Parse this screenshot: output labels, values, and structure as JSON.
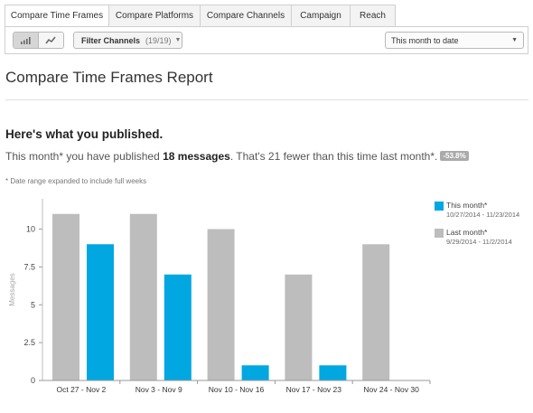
{
  "tabs": [
    {
      "label": "Compare Time Frames",
      "active": true
    },
    {
      "label": "Compare Platforms",
      "active": false
    },
    {
      "label": "Compare Channels",
      "active": false
    },
    {
      "label": "Campaign",
      "active": false
    },
    {
      "label": "Reach",
      "active": false
    }
  ],
  "toolbar": {
    "view_icons": [
      "bar-chart-icon",
      "line-chart-icon"
    ],
    "filter_label": "Filter Channels",
    "filter_count": "(19/19)",
    "date_range_selected": "This month to date"
  },
  "report": {
    "title": "Compare Time Frames Report",
    "heading": "Here's what you published.",
    "summary_prefix": "This month* you have published ",
    "summary_count": "18 messages",
    "summary_suffix": ". That's 21 fewer than this time last month*.",
    "change_badge": "-53.8%",
    "footnote": "* Date range expanded to include full weeks"
  },
  "chart_data": {
    "type": "bar",
    "ylabel": "Messages",
    "ylim": [
      0,
      12
    ],
    "yticks": [
      0,
      2.5,
      5,
      7.5,
      10
    ],
    "ytick_labels": [
      "0",
      "2.5",
      "5",
      "7.5",
      "10"
    ],
    "categories": [
      "Oct 27 - Nov 2",
      "Nov 3 - Nov 9",
      "Nov 10 - Nov 16",
      "Nov 17 - Nov 23",
      "Nov 24 - Nov 30"
    ],
    "series": [
      {
        "name": "Last month*",
        "range": "9/29/2014 - 11/2/2014",
        "color": "#bdbdbd",
        "values": [
          11,
          11,
          10,
          7,
          9
        ]
      },
      {
        "name": "This month*",
        "range": "10/27/2014 - 11/23/2014",
        "color": "#00a7e1",
        "values": [
          9,
          7,
          1,
          1,
          null
        ]
      }
    ],
    "legend_order": [
      1,
      0
    ],
    "legend_position": "right"
  }
}
